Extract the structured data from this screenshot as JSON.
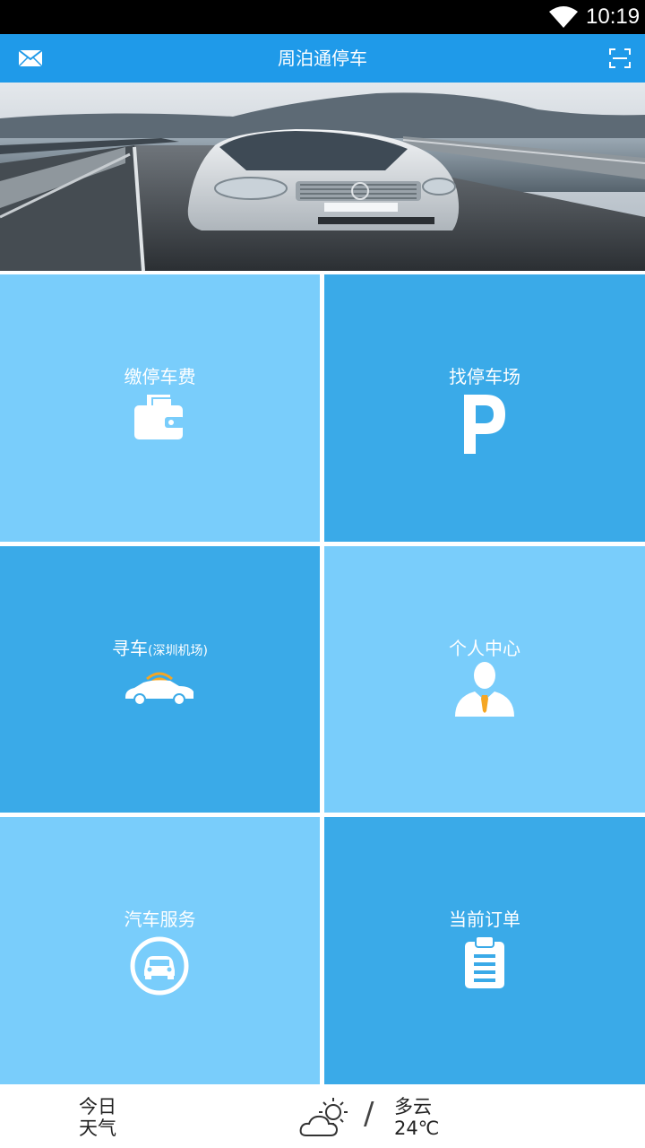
{
  "status": {
    "time": "10:19"
  },
  "app_bar": {
    "title": "周泊通停车",
    "left_icon": "mail-icon",
    "right_icon": "scan-icon"
  },
  "tiles": [
    {
      "label": "缴停车费",
      "icon": "wallet-icon",
      "shade": "light"
    },
    {
      "label": "找停车场",
      "icon": "parking-p-icon",
      "shade": "dark"
    },
    {
      "label": "寻车",
      "label_small": "(深圳机场)",
      "icon": "car-signal-icon",
      "shade": "dark"
    },
    {
      "label": "个人中心",
      "icon": "person-icon",
      "shade": "light"
    },
    {
      "label": "汽车服务",
      "icon": "car-service-icon",
      "shade": "light"
    },
    {
      "label": "当前订单",
      "icon": "clipboard-icon",
      "shade": "dark"
    }
  ],
  "weather": {
    "today_line1": "今日",
    "today_line2": "天气",
    "condition": "多云",
    "temperature": "24℃",
    "icon": "partly-cloudy-icon"
  },
  "colors": {
    "app_bar": "#1f9ae9",
    "tile_light": "#79cdfb",
    "tile_dark": "#3aaae8",
    "accent_orange": "#f5a623"
  }
}
